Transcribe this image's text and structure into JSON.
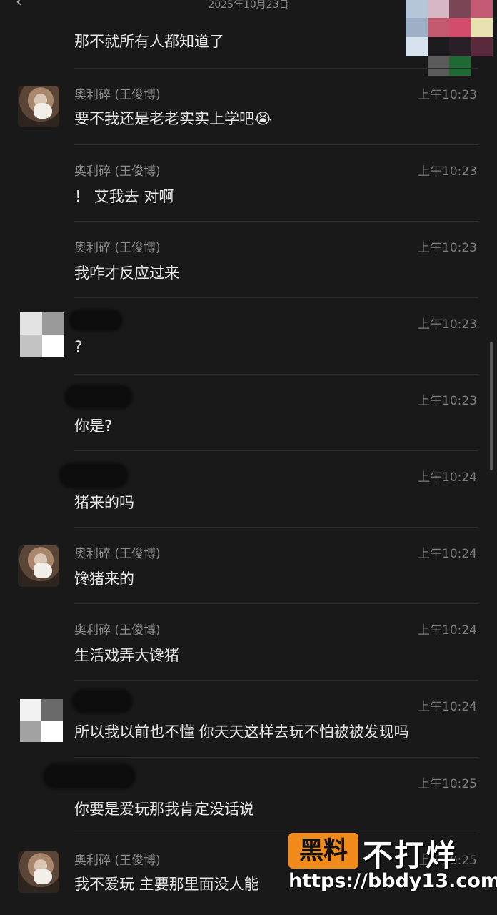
{
  "header": {
    "date": "2025年10月23日",
    "back_icon": "chevron-left-icon",
    "more_icon": "more-icon"
  },
  "messages": [
    {
      "name": "",
      "time": "",
      "text": "那不就所有人都知道了"
    },
    {
      "name": "奥利碎 (王俊博)",
      "time": "上午10:23",
      "text": "要不我还是老老实实上学吧😭"
    },
    {
      "name": "奥利碎 (王俊博)",
      "time": "上午10:23",
      "text": "！ 艾我去 对啊"
    },
    {
      "name": "奥利碎 (王俊博)",
      "time": "上午10:23",
      "text": "我咋才反应过来"
    },
    {
      "name": "",
      "time": "上午10:23",
      "text": "?"
    },
    {
      "name": "",
      "time": "上午10:23",
      "text": "你是?"
    },
    {
      "name": "",
      "time": "上午10:24",
      "text": "猪来的吗"
    },
    {
      "name": "奥利碎 (王俊博)",
      "time": "上午10:24",
      "text": "馋猪来的"
    },
    {
      "name": "奥利碎 (王俊博)",
      "time": "上午10:24",
      "text": "生活戏弄大馋猪"
    },
    {
      "name": "",
      "time": "上午10:24",
      "text": "所以我以前也不懂 你天天这样去玩不怕被被发现吗"
    },
    {
      "name": "",
      "time": "上午10:25",
      "text": "你要是爱玩那我肯定没话说"
    },
    {
      "name": "奥利碎 (王俊博)",
      "time": "上午10:25",
      "text": "我不爱玩 主要那里面没人能"
    }
  ],
  "watermark": {
    "badge": "黑料",
    "title": "不打烊",
    "url": "https://bbdy13.com"
  }
}
